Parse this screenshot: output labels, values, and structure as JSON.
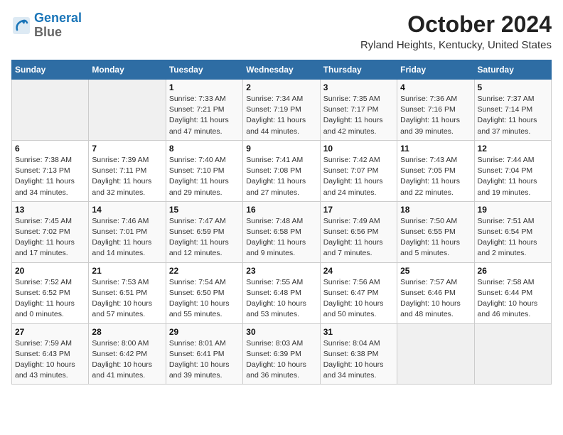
{
  "header": {
    "logo_line1": "General",
    "logo_line2": "Blue",
    "month_title": "October 2024",
    "location": "Ryland Heights, Kentucky, United States"
  },
  "days_of_week": [
    "Sunday",
    "Monday",
    "Tuesday",
    "Wednesday",
    "Thursday",
    "Friday",
    "Saturday"
  ],
  "weeks": [
    [
      {
        "day": "",
        "info": ""
      },
      {
        "day": "",
        "info": ""
      },
      {
        "day": "1",
        "info": "Sunrise: 7:33 AM\nSunset: 7:21 PM\nDaylight: 11 hours and 47 minutes."
      },
      {
        "day": "2",
        "info": "Sunrise: 7:34 AM\nSunset: 7:19 PM\nDaylight: 11 hours and 44 minutes."
      },
      {
        "day": "3",
        "info": "Sunrise: 7:35 AM\nSunset: 7:17 PM\nDaylight: 11 hours and 42 minutes."
      },
      {
        "day": "4",
        "info": "Sunrise: 7:36 AM\nSunset: 7:16 PM\nDaylight: 11 hours and 39 minutes."
      },
      {
        "day": "5",
        "info": "Sunrise: 7:37 AM\nSunset: 7:14 PM\nDaylight: 11 hours and 37 minutes."
      }
    ],
    [
      {
        "day": "6",
        "info": "Sunrise: 7:38 AM\nSunset: 7:13 PM\nDaylight: 11 hours and 34 minutes."
      },
      {
        "day": "7",
        "info": "Sunrise: 7:39 AM\nSunset: 7:11 PM\nDaylight: 11 hours and 32 minutes."
      },
      {
        "day": "8",
        "info": "Sunrise: 7:40 AM\nSunset: 7:10 PM\nDaylight: 11 hours and 29 minutes."
      },
      {
        "day": "9",
        "info": "Sunrise: 7:41 AM\nSunset: 7:08 PM\nDaylight: 11 hours and 27 minutes."
      },
      {
        "day": "10",
        "info": "Sunrise: 7:42 AM\nSunset: 7:07 PM\nDaylight: 11 hours and 24 minutes."
      },
      {
        "day": "11",
        "info": "Sunrise: 7:43 AM\nSunset: 7:05 PM\nDaylight: 11 hours and 22 minutes."
      },
      {
        "day": "12",
        "info": "Sunrise: 7:44 AM\nSunset: 7:04 PM\nDaylight: 11 hours and 19 minutes."
      }
    ],
    [
      {
        "day": "13",
        "info": "Sunrise: 7:45 AM\nSunset: 7:02 PM\nDaylight: 11 hours and 17 minutes."
      },
      {
        "day": "14",
        "info": "Sunrise: 7:46 AM\nSunset: 7:01 PM\nDaylight: 11 hours and 14 minutes."
      },
      {
        "day": "15",
        "info": "Sunrise: 7:47 AM\nSunset: 6:59 PM\nDaylight: 11 hours and 12 minutes."
      },
      {
        "day": "16",
        "info": "Sunrise: 7:48 AM\nSunset: 6:58 PM\nDaylight: 11 hours and 9 minutes."
      },
      {
        "day": "17",
        "info": "Sunrise: 7:49 AM\nSunset: 6:56 PM\nDaylight: 11 hours and 7 minutes."
      },
      {
        "day": "18",
        "info": "Sunrise: 7:50 AM\nSunset: 6:55 PM\nDaylight: 11 hours and 5 minutes."
      },
      {
        "day": "19",
        "info": "Sunrise: 7:51 AM\nSunset: 6:54 PM\nDaylight: 11 hours and 2 minutes."
      }
    ],
    [
      {
        "day": "20",
        "info": "Sunrise: 7:52 AM\nSunset: 6:52 PM\nDaylight: 11 hours and 0 minutes."
      },
      {
        "day": "21",
        "info": "Sunrise: 7:53 AM\nSunset: 6:51 PM\nDaylight: 10 hours and 57 minutes."
      },
      {
        "day": "22",
        "info": "Sunrise: 7:54 AM\nSunset: 6:50 PM\nDaylight: 10 hours and 55 minutes."
      },
      {
        "day": "23",
        "info": "Sunrise: 7:55 AM\nSunset: 6:48 PM\nDaylight: 10 hours and 53 minutes."
      },
      {
        "day": "24",
        "info": "Sunrise: 7:56 AM\nSunset: 6:47 PM\nDaylight: 10 hours and 50 minutes."
      },
      {
        "day": "25",
        "info": "Sunrise: 7:57 AM\nSunset: 6:46 PM\nDaylight: 10 hours and 48 minutes."
      },
      {
        "day": "26",
        "info": "Sunrise: 7:58 AM\nSunset: 6:44 PM\nDaylight: 10 hours and 46 minutes."
      }
    ],
    [
      {
        "day": "27",
        "info": "Sunrise: 7:59 AM\nSunset: 6:43 PM\nDaylight: 10 hours and 43 minutes."
      },
      {
        "day": "28",
        "info": "Sunrise: 8:00 AM\nSunset: 6:42 PM\nDaylight: 10 hours and 41 minutes."
      },
      {
        "day": "29",
        "info": "Sunrise: 8:01 AM\nSunset: 6:41 PM\nDaylight: 10 hours and 39 minutes."
      },
      {
        "day": "30",
        "info": "Sunrise: 8:03 AM\nSunset: 6:39 PM\nDaylight: 10 hours and 36 minutes."
      },
      {
        "day": "31",
        "info": "Sunrise: 8:04 AM\nSunset: 6:38 PM\nDaylight: 10 hours and 34 minutes."
      },
      {
        "day": "",
        "info": ""
      },
      {
        "day": "",
        "info": ""
      }
    ]
  ]
}
